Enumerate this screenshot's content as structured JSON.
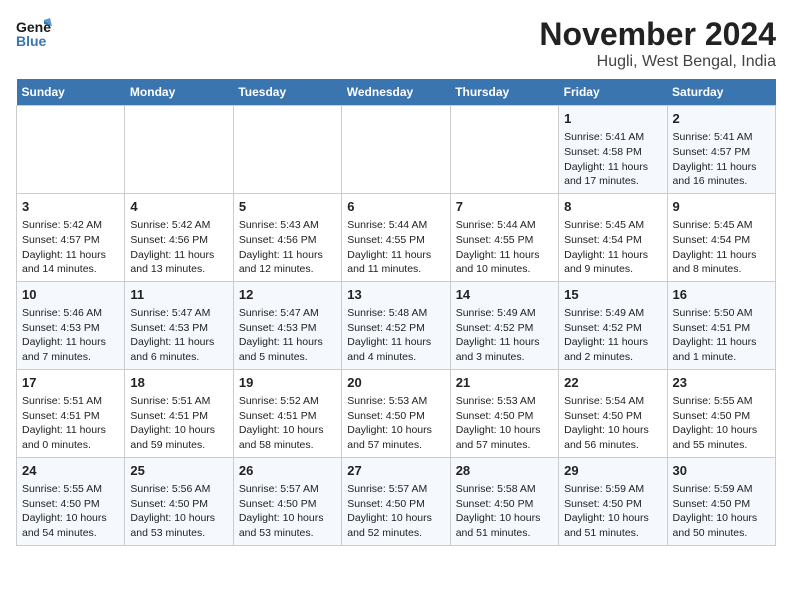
{
  "header": {
    "logo_line1": "General",
    "logo_line2": "Blue",
    "month_title": "November 2024",
    "location": "Hugli, West Bengal, India"
  },
  "weekdays": [
    "Sunday",
    "Monday",
    "Tuesday",
    "Wednesday",
    "Thursday",
    "Friday",
    "Saturday"
  ],
  "weeks": [
    [
      {
        "day": "",
        "data": ""
      },
      {
        "day": "",
        "data": ""
      },
      {
        "day": "",
        "data": ""
      },
      {
        "day": "",
        "data": ""
      },
      {
        "day": "",
        "data": ""
      },
      {
        "day": "1",
        "data": "Sunrise: 5:41 AM\nSunset: 4:58 PM\nDaylight: 11 hours and 17 minutes."
      },
      {
        "day": "2",
        "data": "Sunrise: 5:41 AM\nSunset: 4:57 PM\nDaylight: 11 hours and 16 minutes."
      }
    ],
    [
      {
        "day": "3",
        "data": "Sunrise: 5:42 AM\nSunset: 4:57 PM\nDaylight: 11 hours and 14 minutes."
      },
      {
        "day": "4",
        "data": "Sunrise: 5:42 AM\nSunset: 4:56 PM\nDaylight: 11 hours and 13 minutes."
      },
      {
        "day": "5",
        "data": "Sunrise: 5:43 AM\nSunset: 4:56 PM\nDaylight: 11 hours and 12 minutes."
      },
      {
        "day": "6",
        "data": "Sunrise: 5:44 AM\nSunset: 4:55 PM\nDaylight: 11 hours and 11 minutes."
      },
      {
        "day": "7",
        "data": "Sunrise: 5:44 AM\nSunset: 4:55 PM\nDaylight: 11 hours and 10 minutes."
      },
      {
        "day": "8",
        "data": "Sunrise: 5:45 AM\nSunset: 4:54 PM\nDaylight: 11 hours and 9 minutes."
      },
      {
        "day": "9",
        "data": "Sunrise: 5:45 AM\nSunset: 4:54 PM\nDaylight: 11 hours and 8 minutes."
      }
    ],
    [
      {
        "day": "10",
        "data": "Sunrise: 5:46 AM\nSunset: 4:53 PM\nDaylight: 11 hours and 7 minutes."
      },
      {
        "day": "11",
        "data": "Sunrise: 5:47 AM\nSunset: 4:53 PM\nDaylight: 11 hours and 6 minutes."
      },
      {
        "day": "12",
        "data": "Sunrise: 5:47 AM\nSunset: 4:53 PM\nDaylight: 11 hours and 5 minutes."
      },
      {
        "day": "13",
        "data": "Sunrise: 5:48 AM\nSunset: 4:52 PM\nDaylight: 11 hours and 4 minutes."
      },
      {
        "day": "14",
        "data": "Sunrise: 5:49 AM\nSunset: 4:52 PM\nDaylight: 11 hours and 3 minutes."
      },
      {
        "day": "15",
        "data": "Sunrise: 5:49 AM\nSunset: 4:52 PM\nDaylight: 11 hours and 2 minutes."
      },
      {
        "day": "16",
        "data": "Sunrise: 5:50 AM\nSunset: 4:51 PM\nDaylight: 11 hours and 1 minute."
      }
    ],
    [
      {
        "day": "17",
        "data": "Sunrise: 5:51 AM\nSunset: 4:51 PM\nDaylight: 11 hours and 0 minutes."
      },
      {
        "day": "18",
        "data": "Sunrise: 5:51 AM\nSunset: 4:51 PM\nDaylight: 10 hours and 59 minutes."
      },
      {
        "day": "19",
        "data": "Sunrise: 5:52 AM\nSunset: 4:51 PM\nDaylight: 10 hours and 58 minutes."
      },
      {
        "day": "20",
        "data": "Sunrise: 5:53 AM\nSunset: 4:50 PM\nDaylight: 10 hours and 57 minutes."
      },
      {
        "day": "21",
        "data": "Sunrise: 5:53 AM\nSunset: 4:50 PM\nDaylight: 10 hours and 57 minutes."
      },
      {
        "day": "22",
        "data": "Sunrise: 5:54 AM\nSunset: 4:50 PM\nDaylight: 10 hours and 56 minutes."
      },
      {
        "day": "23",
        "data": "Sunrise: 5:55 AM\nSunset: 4:50 PM\nDaylight: 10 hours and 55 minutes."
      }
    ],
    [
      {
        "day": "24",
        "data": "Sunrise: 5:55 AM\nSunset: 4:50 PM\nDaylight: 10 hours and 54 minutes."
      },
      {
        "day": "25",
        "data": "Sunrise: 5:56 AM\nSunset: 4:50 PM\nDaylight: 10 hours and 53 minutes."
      },
      {
        "day": "26",
        "data": "Sunrise: 5:57 AM\nSunset: 4:50 PM\nDaylight: 10 hours and 53 minutes."
      },
      {
        "day": "27",
        "data": "Sunrise: 5:57 AM\nSunset: 4:50 PM\nDaylight: 10 hours and 52 minutes."
      },
      {
        "day": "28",
        "data": "Sunrise: 5:58 AM\nSunset: 4:50 PM\nDaylight: 10 hours and 51 minutes."
      },
      {
        "day": "29",
        "data": "Sunrise: 5:59 AM\nSunset: 4:50 PM\nDaylight: 10 hours and 51 minutes."
      },
      {
        "day": "30",
        "data": "Sunrise: 5:59 AM\nSunset: 4:50 PM\nDaylight: 10 hours and 50 minutes."
      }
    ]
  ]
}
